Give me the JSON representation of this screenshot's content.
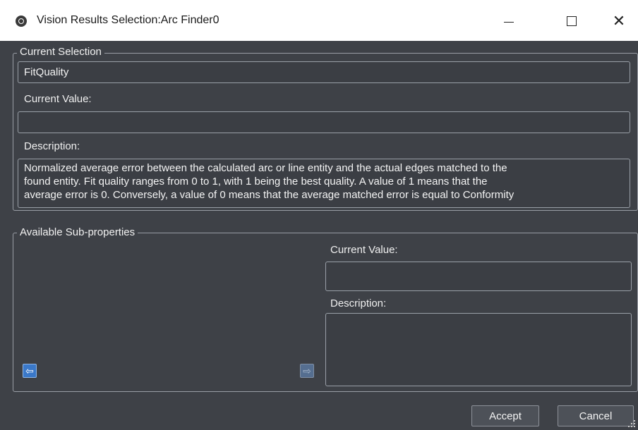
{
  "window": {
    "title": "Vision Results Selection:Arc Finder0",
    "minimize_glyph": "—",
    "maximize_glyph": "☐",
    "close_glyph": "✕"
  },
  "current_selection": {
    "legend": "Current Selection",
    "value": "FitQuality",
    "current_value_label": "Current Value:",
    "current_value": "",
    "description_label": "Description:",
    "description_lines": [
      "Normalized average error between the calculated arc or line entity and the actual edges matched to the",
      "found entity. Fit quality ranges from 0 to 1, with 1 being the best quality. A value of 1 means that the",
      "average error is 0. Conversely, a value of 0 means that the average matched error is equal to Conformity"
    ]
  },
  "sub_properties": {
    "legend": "Available Sub-properties",
    "current_value_label": "Current Value:",
    "current_value": "",
    "description_label": "Description:",
    "description": "",
    "left_arrow_icon": "arrow-left-icon",
    "right_arrow_icon": "arrow-right-icon"
  },
  "buttons": {
    "accept": "Accept",
    "cancel": "Cancel"
  },
  "colors": {
    "background": "#3e4147",
    "border": "#9a9ea6",
    "accent_blue": "#3a78c9"
  }
}
